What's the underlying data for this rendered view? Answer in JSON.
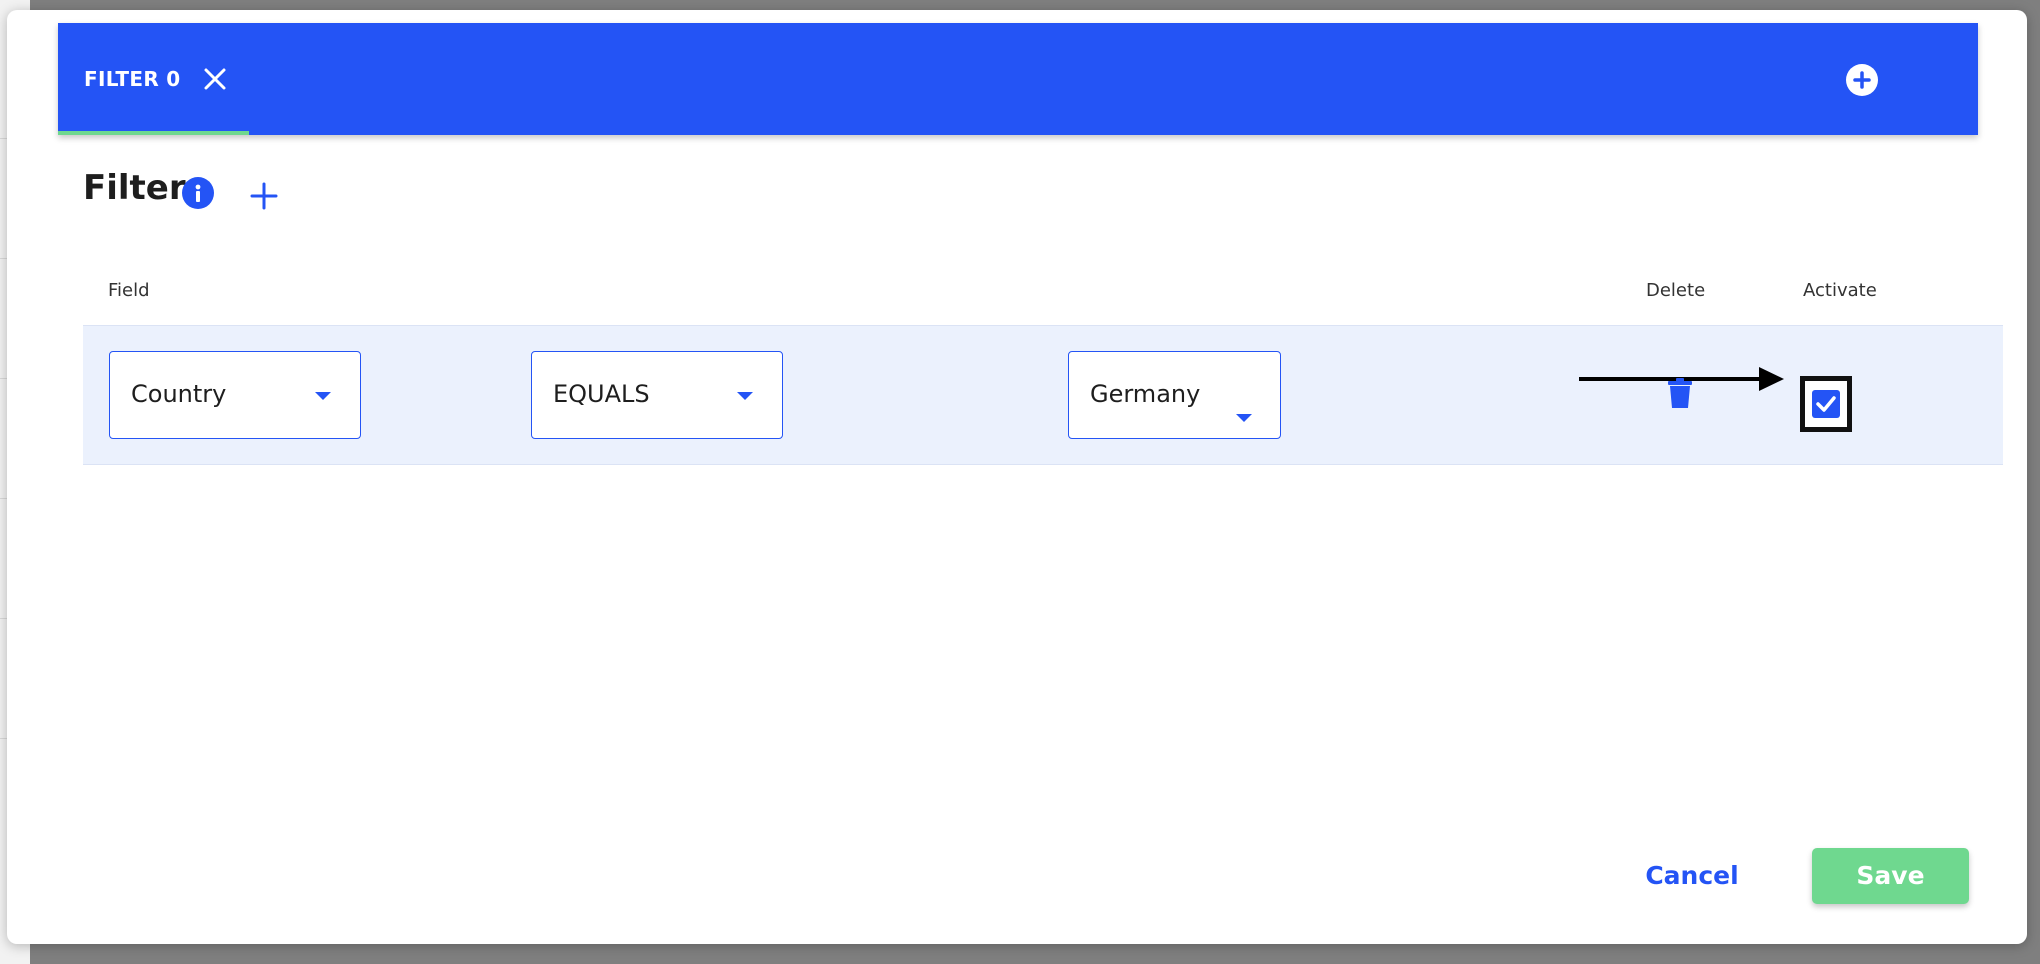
{
  "tabs": [
    {
      "label": "FILTER 0",
      "active": true
    }
  ],
  "panel": {
    "title": "Filter"
  },
  "columns": {
    "field": "Field",
    "delete": "Delete",
    "activate": "Activate"
  },
  "rows": [
    {
      "field": "Country",
      "operator": "EQUALS",
      "value": "Germany",
      "activated": true
    }
  ],
  "actions": {
    "cancel": "Cancel",
    "save": "Save"
  },
  "colors": {
    "primary": "#2454f5",
    "success": "#6fd88f",
    "row_bg": "#ebf1fd"
  },
  "icons": [
    "close-icon",
    "add-tab-icon",
    "info-icon",
    "plus-icon",
    "chevron-down-icon",
    "trash-icon",
    "checkmark-icon",
    "annotation-arrow"
  ]
}
